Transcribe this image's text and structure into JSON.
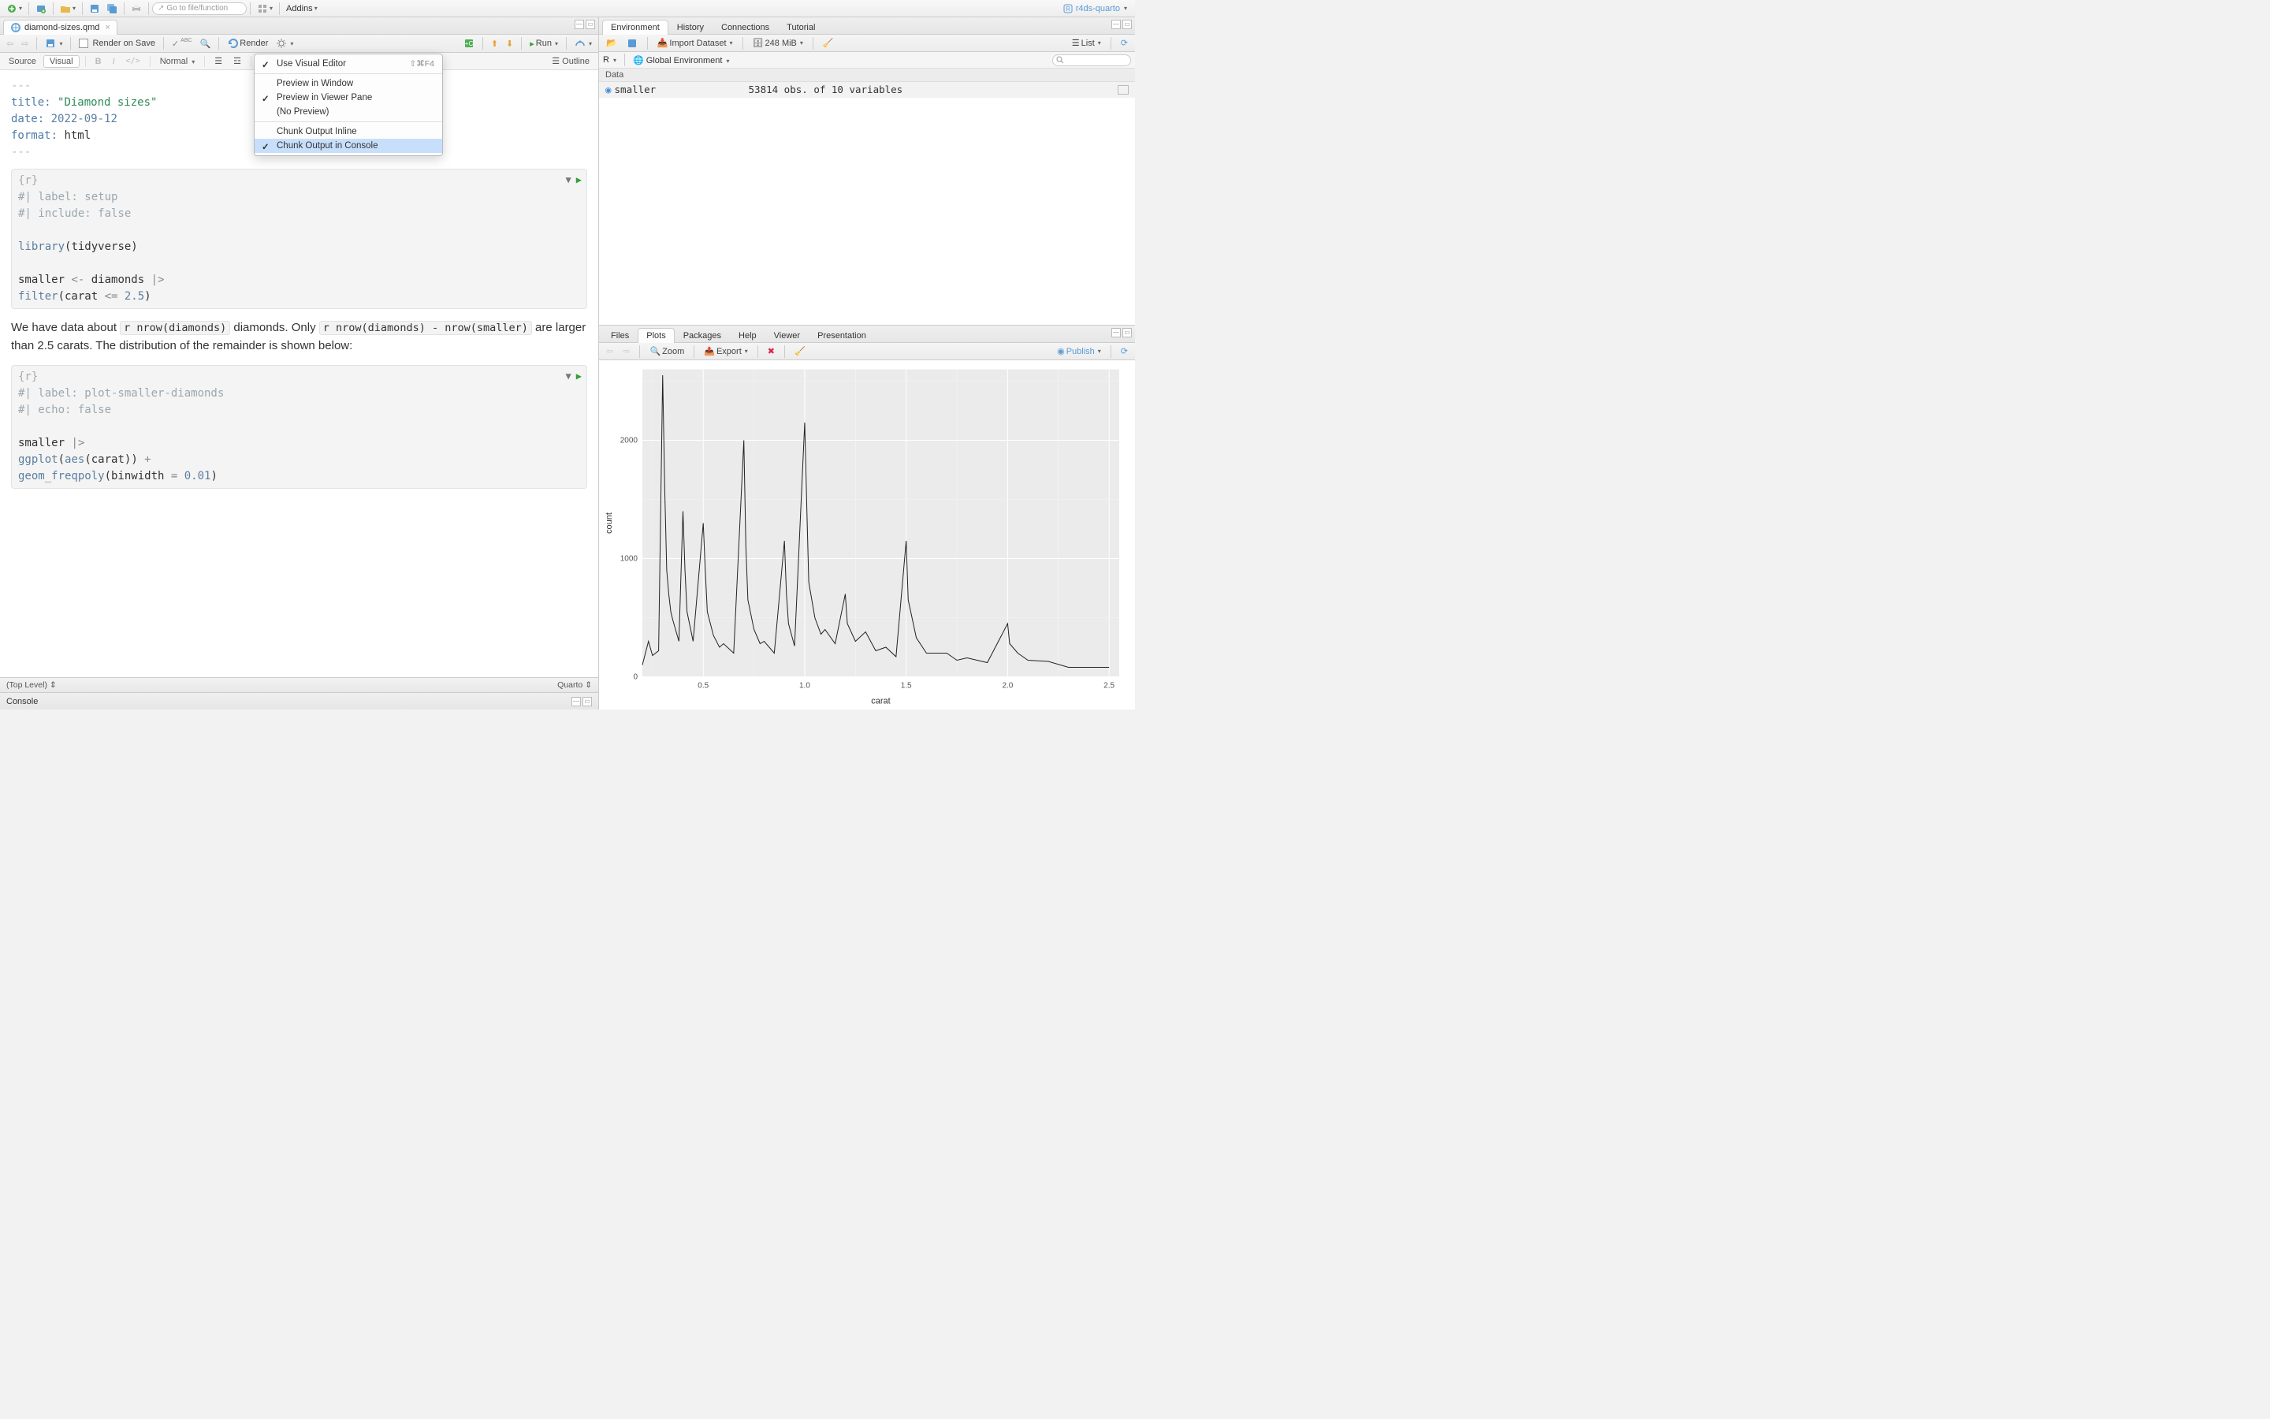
{
  "main_toolbar": {
    "goto_placeholder": "Go to file/function",
    "addins_label": "Addins"
  },
  "project_name": "r4ds-quarto",
  "source": {
    "tab_label": "diamond-sizes.qmd",
    "toolbar": {
      "render_on_save": "Render on Save",
      "render": "Render",
      "run": "Run",
      "outline": "Outline"
    },
    "format_bar": {
      "source": "Source",
      "visual": "Visual",
      "bold": "B",
      "italic": "I",
      "code": "</>",
      "normal": "Normal"
    },
    "popup": {
      "use_visual": "Use Visual Editor",
      "use_visual_short": "⇧⌘F4",
      "preview_window": "Preview in Window",
      "preview_viewer": "Preview in Viewer Pane",
      "no_preview": "(No Preview)",
      "chunk_inline": "Chunk Output Inline",
      "chunk_console": "Chunk Output in Console"
    },
    "yaml": {
      "fence": "---",
      "title_key": "title:",
      "title_val": "\"Diamond sizes\"",
      "date_key": "date:",
      "date_val": "2022-09-12",
      "format_key": "format:",
      "format_val": "html"
    },
    "chunk1": {
      "header": "{r}",
      "label": "#| label: setup",
      "include": "#| include: false",
      "line1a": "library",
      "line1b": "(tidyverse)",
      "line2a": "smaller ",
      "line2b": "<-",
      "line2c": " diamonds ",
      "line2d": "|>",
      "line3a": "  filter",
      "line3b": "(carat ",
      "line3c": "<=",
      "line3d": " 2.5",
      "line3e": ")"
    },
    "prose": {
      "t1": "We have data about ",
      "c1": "r nrow(diamonds)",
      "t2": " diamonds. Only ",
      "c2": "r nrow(diamonds) - nrow(smaller)",
      "t3": " are larger than 2.5 carats. The distribution of the remainder is shown below:"
    },
    "chunk2": {
      "header": "{r}",
      "label": "#| label: plot-smaller-diamonds",
      "echo": "#| echo: false",
      "l1a": "smaller ",
      "l1b": "|>",
      "l2a": "  ggplot",
      "l2b": "(",
      "l2c": "aes",
      "l2d": "(carat)) ",
      "l2e": "+",
      "l3a": "  geom_freqpoly",
      "l3b": "(binwidth ",
      "l3c": "=",
      "l3d": " 0.01",
      "l3e": ")"
    },
    "status": {
      "scope": "(Top Level)",
      "type": "Quarto"
    },
    "console_label": "Console"
  },
  "env": {
    "tabs": [
      "Environment",
      "History",
      "Connections",
      "Tutorial"
    ],
    "toolbar": {
      "import": "Import Dataset",
      "mem": "248 MiB",
      "list": "List"
    },
    "subbar": {
      "lang": "R",
      "scope": "Global Environment"
    },
    "section": "Data",
    "row": {
      "name": "smaller",
      "desc": "53814 obs. of 10 variables"
    }
  },
  "plots": {
    "tabs": [
      "Files",
      "Plots",
      "Packages",
      "Help",
      "Viewer",
      "Presentation"
    ],
    "toolbar": {
      "zoom": "Zoom",
      "export": "Export",
      "publish": "Publish"
    }
  },
  "chart_data": {
    "type": "line",
    "title": "",
    "xlabel": "carat",
    "ylabel": "count",
    "xlim": [
      0.2,
      2.55
    ],
    "ylim": [
      0,
      2600
    ],
    "x_ticks": [
      0.5,
      1.0,
      1.5,
      2.0,
      2.5
    ],
    "y_ticks": [
      0,
      1000,
      2000
    ],
    "series": [
      {
        "name": "count",
        "x": [
          0.2,
          0.23,
          0.25,
          0.28,
          0.3,
          0.31,
          0.32,
          0.33,
          0.34,
          0.35,
          0.38,
          0.4,
          0.41,
          0.42,
          0.45,
          0.5,
          0.51,
          0.52,
          0.55,
          0.58,
          0.6,
          0.65,
          0.7,
          0.71,
          0.72,
          0.75,
          0.78,
          0.8,
          0.85,
          0.9,
          0.91,
          0.92,
          0.95,
          1.0,
          1.01,
          1.02,
          1.05,
          1.08,
          1.1,
          1.15,
          1.2,
          1.21,
          1.25,
          1.3,
          1.35,
          1.4,
          1.45,
          1.5,
          1.51,
          1.55,
          1.6,
          1.7,
          1.75,
          1.8,
          1.9,
          2.0,
          2.01,
          2.05,
          2.1,
          2.2,
          2.3,
          2.4,
          2.5
        ],
        "y": [
          100,
          300,
          180,
          220,
          2550,
          1600,
          900,
          700,
          550,
          480,
          300,
          1400,
          900,
          550,
          300,
          1300,
          900,
          550,
          350,
          250,
          280,
          200,
          2000,
          1100,
          650,
          400,
          280,
          300,
          200,
          1150,
          700,
          450,
          260,
          2150,
          1450,
          800,
          500,
          360,
          400,
          280,
          700,
          450,
          300,
          380,
          220,
          250,
          170,
          1150,
          650,
          330,
          200,
          200,
          140,
          160,
          120,
          450,
          280,
          200,
          140,
          130,
          80,
          80,
          80
        ]
      }
    ]
  }
}
